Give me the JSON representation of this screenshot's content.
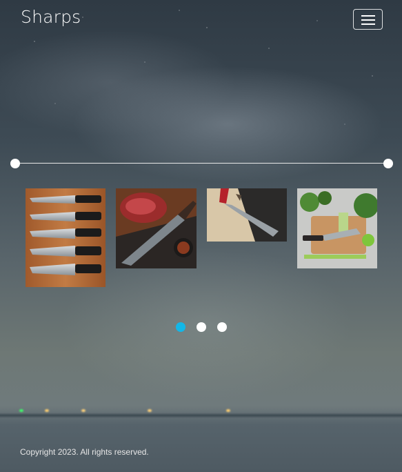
{
  "header": {
    "brand": "Sharps",
    "menu_icon": "hamburger-menu-icon"
  },
  "range_slider": {
    "start_value": 0,
    "end_value": 1
  },
  "gallery": {
    "images": [
      {
        "name": "knife-set-on-board",
        "icon": "knife-set-image"
      },
      {
        "name": "damascus-knife-with-steak",
        "icon": "steak-knife-image"
      },
      {
        "name": "red-handle-knife-with-box",
        "icon": "red-handle-knife-image"
      },
      {
        "name": "knife-with-vegetables",
        "icon": "vegetable-knife-image"
      }
    ]
  },
  "pagination": {
    "count": 3,
    "active_index": 0,
    "active_color": "#13b7e8",
    "inactive_color": "#ffffff"
  },
  "footer": {
    "copyright": "Copyright 2023. All rights reserved."
  }
}
